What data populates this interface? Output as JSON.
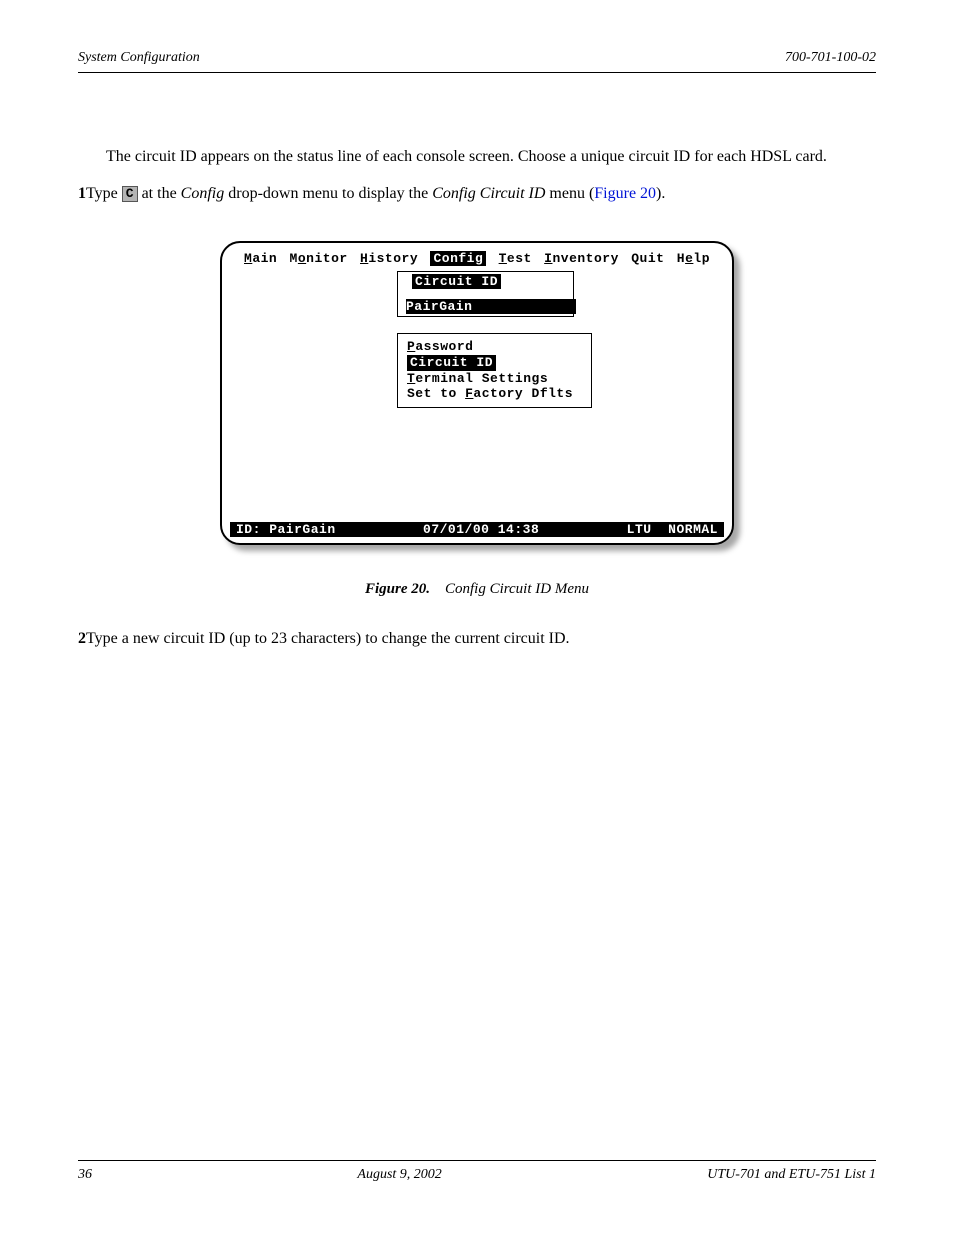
{
  "header": {
    "left": "System Configuration",
    "right": "700-701-100-02"
  },
  "para1": "The circuit ID appears on the status line of each console screen. Choose a unique circuit ID for each HDSL card.",
  "step1_num": "1",
  "step1_a": "Type ",
  "step1_key": "C",
  "step1_b": " at the ",
  "step1_config": "Config",
  "step1_c": " drop-down menu to display the ",
  "step1_menu": "Config Circuit ID",
  "step1_d": " menu (",
  "step1_link": "Figure 20",
  "step1_e": ").",
  "menubar": {
    "main": "Main",
    "monitor": "Monitor",
    "history": "History",
    "config": "Config",
    "test": "Test",
    "inventory": "Inventory",
    "quit": "Quit",
    "help": "Help"
  },
  "sub1_title": "Circuit ID",
  "sub1_value": "PairGain",
  "sub2": {
    "password": "Password",
    "circuit": "Circuit ID",
    "terminal": "Terminal Settings",
    "factory": "Set to Factory Dflts"
  },
  "status": {
    "left": "ID: PairGain",
    "center": "07/01/00 14:38",
    "r1": "LTU",
    "r2": "NORMAL"
  },
  "caption": {
    "label": "Figure 20.",
    "title": "Config Circuit ID Menu"
  },
  "step2_num": "2",
  "step2": "Type a new circuit ID (up to 23 characters) to change the current circuit ID.",
  "footer": {
    "left": "36",
    "center": "August 9, 2002",
    "right": "UTU-701 and ETU-751 List 1"
  }
}
